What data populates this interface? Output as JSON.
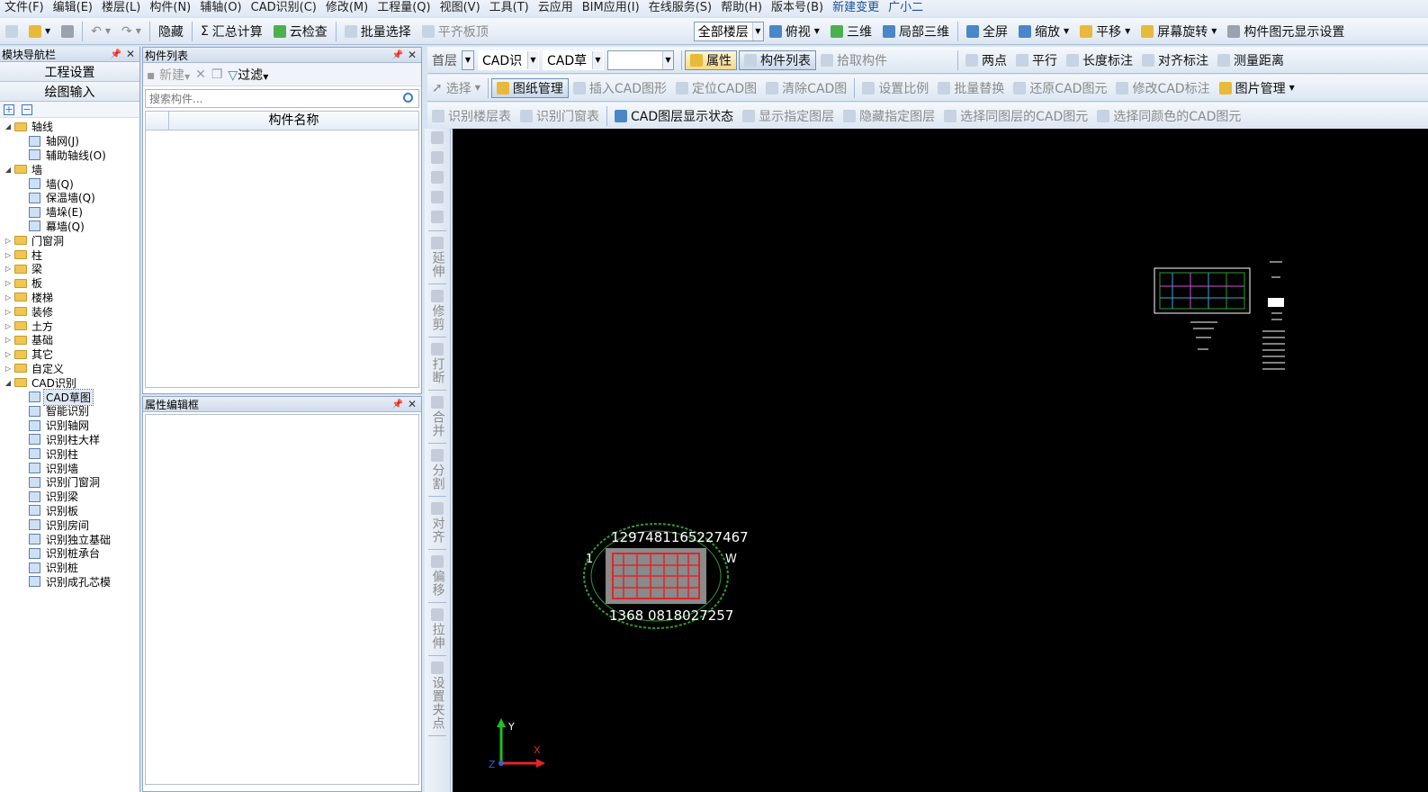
{
  "menu": [
    "文件(F)",
    "编辑(E)",
    "楼层(L)",
    "构件(N)",
    "辅轴(O)",
    "CAD识别(C)",
    "修改(M)",
    "工程量(Q)",
    "视图(V)",
    "工具(T)",
    "云应用",
    "BIM应用(I)",
    "在线服务(S)",
    "帮助(H)",
    "版本号(B)",
    "新建变更",
    "广小二"
  ],
  "toolbar": {
    "hide": "隐藏",
    "summary": "汇总计算",
    "cloud_check": "云检查",
    "batch_select": "批量选择",
    "level_slab": "平齐板顶",
    "floor_select": "全部楼层",
    "top_view": "俯视",
    "three_d": "三维",
    "partial_3d": "局部三维",
    "fullscreen": "全屏",
    "zoom": "缩放",
    "pan": "平移",
    "rotate": "屏幕旋转",
    "display_settings": "构件图元显示设置"
  },
  "nav": {
    "title": "模块导航栏",
    "tab_project": "工程设置",
    "tab_drawing": "绘图输入",
    "tree": [
      {
        "label": "轴线",
        "level": 0,
        "expanded": true,
        "folder": true
      },
      {
        "label": "轴网(J)",
        "level": 1,
        "name": "tree-item-grid"
      },
      {
        "label": "辅助轴线(O)",
        "level": 1,
        "name": "tree-item-aux-axis"
      },
      {
        "label": "墙",
        "level": 0,
        "expanded": true,
        "folder": true
      },
      {
        "label": "墙(Q)",
        "level": 1,
        "name": "tree-item-wall"
      },
      {
        "label": "保温墙(Q)",
        "level": 1,
        "name": "tree-item-insulation-wall"
      },
      {
        "label": "墙垛(E)",
        "level": 1,
        "name": "tree-item-wall-pier"
      },
      {
        "label": "幕墙(Q)",
        "level": 1,
        "name": "tree-item-curtain-wall"
      },
      {
        "label": "门窗洞",
        "level": 0,
        "folder": true
      },
      {
        "label": "柱",
        "level": 0,
        "folder": true
      },
      {
        "label": "梁",
        "level": 0,
        "folder": true
      },
      {
        "label": "板",
        "level": 0,
        "folder": true
      },
      {
        "label": "楼梯",
        "level": 0,
        "folder": true
      },
      {
        "label": "装修",
        "level": 0,
        "folder": true
      },
      {
        "label": "土方",
        "level": 0,
        "folder": true
      },
      {
        "label": "基础",
        "level": 0,
        "folder": true
      },
      {
        "label": "其它",
        "level": 0,
        "folder": true
      },
      {
        "label": "自定义",
        "level": 0,
        "folder": true
      },
      {
        "label": "CAD识别",
        "level": 0,
        "expanded": true,
        "folder": true
      },
      {
        "label": "CAD草图",
        "level": 1,
        "selected": true,
        "name": "tree-item-cad-sketch"
      },
      {
        "label": "智能识别",
        "level": 1,
        "name": "tree-item-smart-recognize"
      },
      {
        "label": "识别轴网",
        "level": 1,
        "name": "tree-item-recognize-grid"
      },
      {
        "label": "识别柱大样",
        "level": 1,
        "name": "tree-item-recognize-column-detail"
      },
      {
        "label": "识别柱",
        "level": 1,
        "name": "tree-item-recognize-column"
      },
      {
        "label": "识别墙",
        "level": 1,
        "name": "tree-item-recognize-wall"
      },
      {
        "label": "识别门窗洞",
        "level": 1,
        "name": "tree-item-recognize-openings"
      },
      {
        "label": "识别梁",
        "level": 1,
        "name": "tree-item-recognize-beam"
      },
      {
        "label": "识别板",
        "level": 1,
        "name": "tree-item-recognize-slab"
      },
      {
        "label": "识别房间",
        "level": 1,
        "name": "tree-item-recognize-room"
      },
      {
        "label": "识别独立基础",
        "level": 1,
        "name": "tree-item-recognize-footing"
      },
      {
        "label": "识别桩承台",
        "level": 1,
        "name": "tree-item-recognize-pile-cap"
      },
      {
        "label": "识别桩",
        "level": 1,
        "name": "tree-item-recognize-pile"
      },
      {
        "label": "识别成孔芯模",
        "level": 1,
        "name": "tree-item-recognize-core-mold"
      }
    ]
  },
  "component_list": {
    "title": "构件列表",
    "new": "新建",
    "filter": "过滤",
    "search_placeholder": "搜索构件...",
    "column_name": "构件名称"
  },
  "property_editor": {
    "title": "属性编辑框"
  },
  "cad_toolbar1": {
    "floor": "首层",
    "cad_recognize": "CAD识",
    "cad_sketch": "CAD草",
    "empty_combo": "",
    "properties": "属性",
    "component_list": "构件列表",
    "pick_component": "拾取构件",
    "two_points": "两点",
    "parallel": "平行",
    "length_dim": "长度标注",
    "align_dim": "对齐标注",
    "measure": "测量距离"
  },
  "cad_toolbar2": {
    "select": "选择",
    "drawing_mgmt": "图纸管理",
    "insert_cad": "插入CAD图形",
    "locate_cad": "定位CAD图",
    "clear_cad": "清除CAD图",
    "set_scale": "设置比例",
    "batch_replace": "批量替换",
    "restore_cad": "还原CAD图元",
    "modify_cad_dim": "修改CAD标注",
    "image_mgmt": "图片管理"
  },
  "cad_toolbar3": {
    "recognize_floor_table": "识别楼层表",
    "recognize_door_window_table": "识别门窗表",
    "layer_display": "CAD图层显示状态",
    "show_layer": "显示指定图层",
    "hide_layer": "隐藏指定图层",
    "select_same_layer": "选择同图层的CAD图元",
    "select_same_color": "选择同颜色的CAD图元"
  },
  "vertical_tools": [
    "延伸",
    "修剪",
    "打断",
    "合并",
    "分割",
    "对齐",
    "偏移",
    "拉伸",
    "设置夹点"
  ],
  "canvas": {
    "label_top": "1297481165227467",
    "label_bottom": "1368 0818027257",
    "label_left": "1",
    "label_right_v": "W",
    "axis_x": "X",
    "axis_y": "Y",
    "axis_z": "Z",
    "colors": {
      "background": "#000000",
      "green": "#2e9c2e",
      "red": "#e0242c",
      "white": "#ffffff"
    }
  }
}
